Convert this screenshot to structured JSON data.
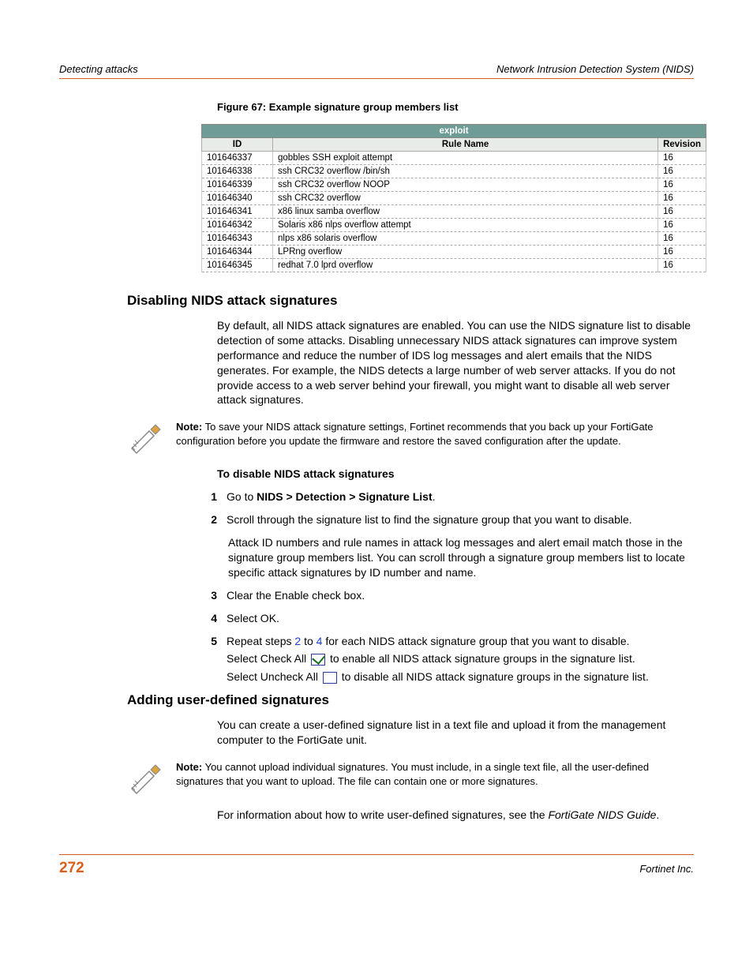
{
  "header": {
    "left": "Detecting attacks",
    "right": "Network Intrusion Detection System (NIDS)"
  },
  "figure_caption": "Figure 67: Example signature group members list",
  "table": {
    "group": "exploit",
    "cols": {
      "id": "ID",
      "name": "Rule Name",
      "rev": "Revision"
    },
    "rows": [
      {
        "id": "101646337",
        "name": "gobbles SSH exploit attempt",
        "rev": "16"
      },
      {
        "id": "101646338",
        "name": "ssh CRC32 overflow /bin/sh",
        "rev": "16"
      },
      {
        "id": "101646339",
        "name": "ssh CRC32 overflow NOOP",
        "rev": "16"
      },
      {
        "id": "101646340",
        "name": "ssh CRC32 overflow",
        "rev": "16"
      },
      {
        "id": "101646341",
        "name": "x86 linux samba overflow",
        "rev": "16"
      },
      {
        "id": "101646342",
        "name": "Solaris x86 nlps overflow attempt",
        "rev": "16"
      },
      {
        "id": "101646343",
        "name": "nlps x86 solaris overflow",
        "rev": "16"
      },
      {
        "id": "101646344",
        "name": "LPRng overflow",
        "rev": "16"
      },
      {
        "id": "101646345",
        "name": "redhat 7.0 lprd overflow",
        "rev": "16"
      }
    ]
  },
  "section1": {
    "title": "Disabling NIDS attack signatures",
    "intro": "By default, all NIDS attack signatures are enabled. You can use the NIDS signature list to disable detection of some attacks. Disabling unnecessary NIDS attack signatures can improve system performance and reduce the number of IDS log messages and alert emails that the NIDS generates. For example, the NIDS detects a large number of web server attacks. If you do not provide access to a web server behind your firewall, you might want to disable all web server attack signatures.",
    "note_label": "Note:",
    "note": " To save your NIDS attack signature settings, Fortinet recommends that you back up your FortiGate configuration before you update the firmware and restore the saved configuration after the update.",
    "procedure_title": "To disable NIDS attack signatures",
    "steps": {
      "s1_pre": "Go to ",
      "s1_bold": "NIDS > Detection > Signature List",
      "s1_post": ".",
      "s2": "Scroll through the signature list to find the signature group that you want to disable.",
      "s2_sub": "Attack ID numbers and rule names in attack log messages and alert email match those in the signature group members list. You can scroll through a signature group members list to locate specific attack signatures by ID number and name.",
      "s3": "Clear the Enable check box.",
      "s4": "Select OK.",
      "s5_a": "Repeat steps ",
      "s5_link1": "2",
      "s5_b": " to ",
      "s5_link2": "4",
      "s5_c": " for each NIDS attack signature group that you want to disable.",
      "s5_sub1_a": "Select Check All ",
      "s5_sub1_b": " to enable all NIDS attack signature groups in the signature list.",
      "s5_sub2_a": "Select Uncheck All ",
      "s5_sub2_b": " to disable all NIDS attack signature groups in the signature list."
    }
  },
  "section2": {
    "title": "Adding user-defined signatures",
    "intro": "You can create a user-defined signature list in a text file and upload it from the management computer to the FortiGate unit.",
    "note_label": "Note:",
    "note": " You cannot upload individual signatures. You must include, in a single text file, all the user-defined signatures that you want to upload. The file can contain one or more signatures.",
    "para2_a": "For information about how to write user-defined signatures, see the ",
    "para2_i": "FortiGate NIDS Guide",
    "para2_b": "."
  },
  "footer": {
    "page": "272",
    "right": "Fortinet Inc."
  }
}
